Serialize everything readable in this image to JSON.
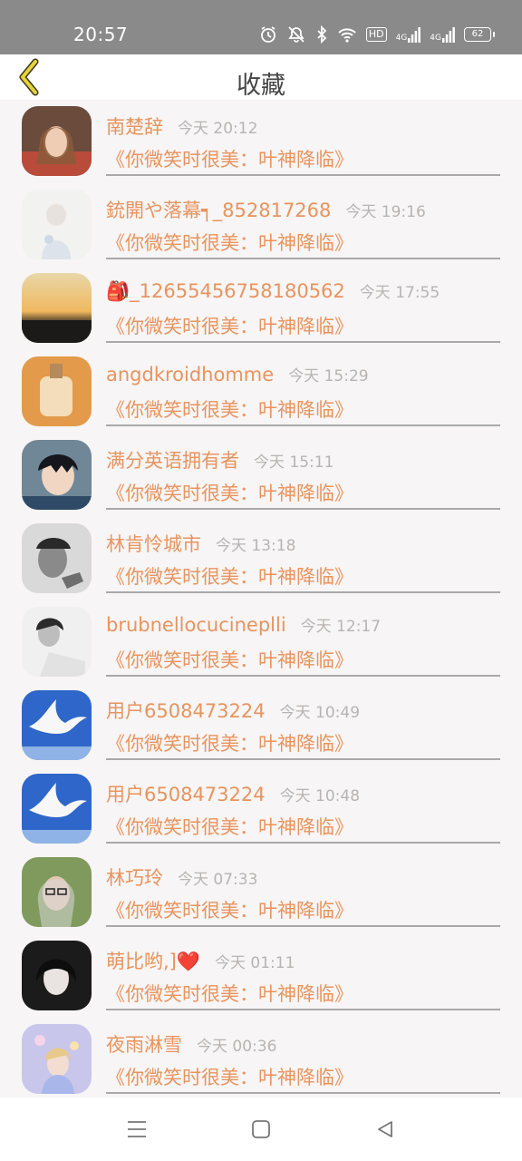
{
  "status_bar": {
    "time": "20:57",
    "battery": "62",
    "network_1": "4G",
    "network_2": "4G",
    "hd_label": "HD",
    "icons": [
      "alarm-icon",
      "mute-icon",
      "bluetooth-icon",
      "wifi-icon",
      "hd-icon",
      "signal-icon",
      "signal-icon",
      "battery-icon"
    ]
  },
  "header": {
    "title": "收藏",
    "back_icon": "chevron-left-icon",
    "accent_color": "#e8945e"
  },
  "items": [
    {
      "user": "南楚辞",
      "time": "今天 20:12",
      "title": "《你微笑时很美：叶神降临》",
      "avatar": "woman-portrait"
    },
    {
      "user": "銃開や落幕┑_852817268",
      "time": "今天 19:16",
      "title": "《你微笑时很美：叶神降临》",
      "avatar": "white-figure"
    },
    {
      "user": "🎒_12655456758180562",
      "time": "今天 17:55",
      "title": "《你微笑时很美：叶神降临》",
      "avatar": "sunset"
    },
    {
      "user": "angdkroidhomme",
      "time": "今天 15:29",
      "title": "《你微笑时很美：叶神降临》",
      "avatar": "bottle"
    },
    {
      "user": "满分英语拥有者",
      "time": "今天 15:11",
      "title": "《你微笑时很美：叶神降临》",
      "avatar": "anime-boy"
    },
    {
      "user": "林肯怜城市",
      "time": "今天 13:18",
      "title": "《你微笑时很美：叶神降临》",
      "avatar": "man-bw"
    },
    {
      "user": "brubnellocucineplli",
      "time": "今天 12:17",
      "title": "《你微笑时很美：叶神降临》",
      "avatar": "woman-bw"
    },
    {
      "user": "用户6508473224",
      "time": "今天 10:49",
      "title": "《你微笑时很美：叶神降临》",
      "avatar": "dove"
    },
    {
      "user": "用户6508473224",
      "time": "今天 10:48",
      "title": "《你微笑时很美：叶神降临》",
      "avatar": "dove"
    },
    {
      "user": "林巧玲",
      "time": "今天 07:33",
      "title": "《你微笑时很美：叶神降临》",
      "avatar": "woman-glasses"
    },
    {
      "user": "萌比哟,]❤️",
      "time": "今天 01:11",
      "title": "《你微笑时很美：叶神降临》",
      "avatar": "woman-dark"
    },
    {
      "user": "夜雨淋雪",
      "time": "今天 00:36",
      "title": "《你微笑时很美：叶神降临》",
      "avatar": "anime-girl"
    }
  ],
  "nav": {
    "menu_icon": "menu-icon",
    "home_icon": "home-square-icon",
    "back_icon": "back-triangle-icon"
  }
}
